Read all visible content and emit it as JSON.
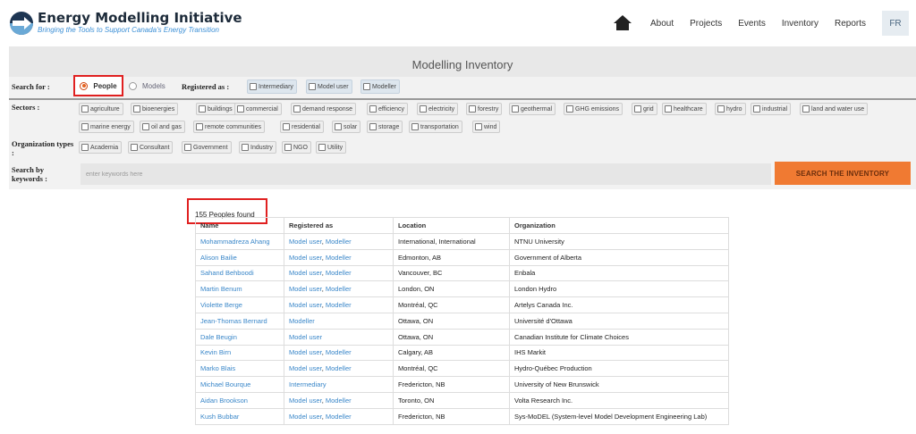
{
  "header": {
    "title": "Energy Modelling Initiative",
    "subtitle": "Bringing the Tools to Support Canada's Energy Transition",
    "nav": [
      "About",
      "Projects",
      "Events",
      "Inventory",
      "Reports"
    ],
    "lang": "FR"
  },
  "banner": {
    "title": "Modelling Inventory"
  },
  "search": {
    "search_for_label": "Search for :",
    "people_label": "People",
    "models_label": "Models",
    "selected": "People",
    "registered_label": "Registered as :",
    "registered": [
      "Intermediary",
      "Model user",
      "Modeller"
    ],
    "sectors_label": "Sectors :",
    "sectors_row1": [
      "agriculture",
      "bioenergies",
      "buildings",
      "commercial",
      "demand response",
      "efficiency",
      "electricity",
      "forestry",
      "geothermal",
      "GHG emissions",
      "grid",
      "healthcare",
      "hydro",
      "industrial",
      "land and water use"
    ],
    "sectors_row2": [
      "marine energy",
      "oil and gas",
      "remote communities",
      "residential",
      "solar",
      "storage",
      "transportation",
      "wind"
    ],
    "org_label": "Organization types :",
    "org_types": [
      "Academia",
      "Consultant",
      "Government",
      "Industry",
      "NGO",
      "Utility"
    ],
    "keywords_label": "Search by keywords :",
    "keywords_placeholder": "enter keywords here",
    "button_label": "SEARCH THE INVENTORY"
  },
  "results": {
    "count_text": "155 Peoples found",
    "columns": [
      "Name",
      "Registered as",
      "Location",
      "Organization"
    ],
    "rows": [
      {
        "name": "Mohammadreza Ahang",
        "registered": [
          "Model user",
          "Modeller"
        ],
        "location": "International, International",
        "organization": "NTNU University"
      },
      {
        "name": "Alison Bailie",
        "registered": [
          "Model user",
          "Modeller"
        ],
        "location": "Edmonton, AB",
        "organization": "Government of Alberta"
      },
      {
        "name": "Sahand Behboodi",
        "registered": [
          "Model user",
          "Modeller"
        ],
        "location": "Vancouver, BC",
        "organization": "Enbala"
      },
      {
        "name": "Martin Benum",
        "registered": [
          "Model user",
          "Modeller"
        ],
        "location": "London, ON",
        "organization": "London Hydro"
      },
      {
        "name": "Violette Berge",
        "registered": [
          "Model user",
          "Modeller"
        ],
        "location": "Montréal, QC",
        "organization": "Artelys Canada Inc."
      },
      {
        "name": "Jean-Thomas Bernard",
        "registered": [
          "Modeller"
        ],
        "location": "Ottawa, ON",
        "organization": "Université d'Ottawa"
      },
      {
        "name": "Dale Beugin",
        "registered": [
          "Model user"
        ],
        "location": "Ottawa, ON",
        "organization": "Canadian Institute for Climate Choices"
      },
      {
        "name": "Kevin Birn",
        "registered": [
          "Model user",
          "Modeller"
        ],
        "location": "Calgary, AB",
        "organization": "IHS Markit"
      },
      {
        "name": "Marko Blais",
        "registered": [
          "Model user",
          "Modeller"
        ],
        "location": "Montréal, QC",
        "organization": "Hydro-Québec Production"
      },
      {
        "name": "Michael Bourque",
        "registered": [
          "Intermediary"
        ],
        "location": "Fredericton, NB",
        "organization": "University of New Brunswick"
      },
      {
        "name": "Aidan Brookson",
        "registered": [
          "Model user",
          "Modeller"
        ],
        "location": "Toronto, ON",
        "organization": "Volta Research Inc."
      },
      {
        "name": "Kush Bubbar",
        "registered": [
          "Model user",
          "Modeller"
        ],
        "location": "Fredericton, NB",
        "organization": "Sys-MoDEL (System-level Model Development Engineering Lab)"
      }
    ]
  }
}
